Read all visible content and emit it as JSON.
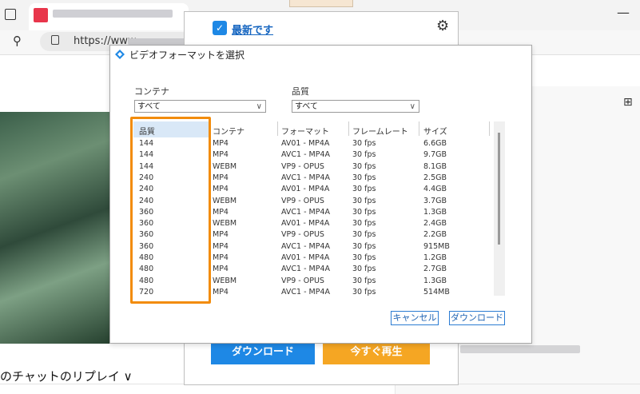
{
  "browser": {
    "url_prefix": "https://www"
  },
  "update_panel": {
    "status_text": "最新です",
    "download_button": "ダウンロード",
    "play_button": "今すぐ再生"
  },
  "dialog": {
    "title": "ビデオフォーマットを選択",
    "container_label": "コンテナ",
    "container_value": "すべて",
    "quality_label": "品質",
    "quality_value": "すべて",
    "columns": {
      "quality": "品質",
      "container": "コンテナ",
      "format": "フォーマット",
      "framerate": "フレームレート",
      "size": "サイズ"
    },
    "rows": [
      {
        "quality": "144",
        "container": "MP4",
        "format": "AV01 - MP4A",
        "framerate": "30 fps",
        "size": "6.6GB"
      },
      {
        "quality": "144",
        "container": "MP4",
        "format": "AVC1 - MP4A",
        "framerate": "30 fps",
        "size": "9.7GB"
      },
      {
        "quality": "144",
        "container": "WEBM",
        "format": "VP9 - OPUS",
        "framerate": "30 fps",
        "size": "8.1GB"
      },
      {
        "quality": "240",
        "container": "MP4",
        "format": "AVC1 - MP4A",
        "framerate": "30 fps",
        "size": "2.5GB"
      },
      {
        "quality": "240",
        "container": "MP4",
        "format": "AV01 - MP4A",
        "framerate": "30 fps",
        "size": "4.4GB"
      },
      {
        "quality": "240",
        "container": "WEBM",
        "format": "VP9 - OPUS",
        "framerate": "30 fps",
        "size": "3.7GB"
      },
      {
        "quality": "360",
        "container": "MP4",
        "format": "AVC1 - MP4A",
        "framerate": "30 fps",
        "size": "1.3GB"
      },
      {
        "quality": "360",
        "container": "WEBM",
        "format": "AV01 - MP4A",
        "framerate": "30 fps",
        "size": "2.4GB"
      },
      {
        "quality": "360",
        "container": "MP4",
        "format": "VP9 - OPUS",
        "framerate": "30 fps",
        "size": "2.2GB"
      },
      {
        "quality": "360",
        "container": "MP4",
        "format": "AVC1 - MP4A",
        "framerate": "30 fps",
        "size": "915MB"
      },
      {
        "quality": "480",
        "container": "MP4",
        "format": "AV01 - MP4A",
        "framerate": "30 fps",
        "size": "1.2GB"
      },
      {
        "quality": "480",
        "container": "MP4",
        "format": "AVC1 - MP4A",
        "framerate": "30 fps",
        "size": "2.7GB"
      },
      {
        "quality": "480",
        "container": "WEBM",
        "format": "VP9 - OPUS",
        "framerate": "30 fps",
        "size": "1.3GB"
      },
      {
        "quality": "720",
        "container": "MP4",
        "format": "AVC1 - MP4A",
        "framerate": "30 fps",
        "size": "514MB"
      }
    ],
    "cancel_button": "キャンセル",
    "download_button": "ダウンロード"
  },
  "page": {
    "chat_replay": "のチャットのリプレイ ∨"
  },
  "colors": {
    "highlight": "#f28c0c",
    "accent_blue": "#1e88e5",
    "accent_orange": "#f5a623"
  }
}
